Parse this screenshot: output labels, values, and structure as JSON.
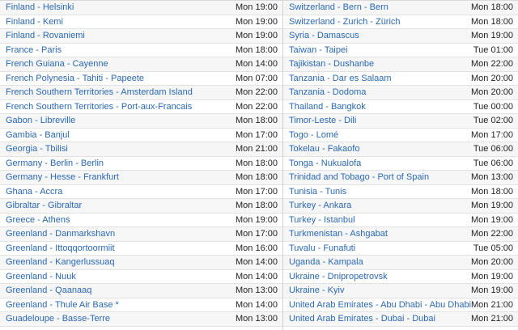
{
  "left_column": [
    {
      "city": "Finland - Helsinki",
      "time": "Mon 19:00"
    },
    {
      "city": "Finland - Kemi",
      "time": "Mon 19:00"
    },
    {
      "city": "Finland - Rovaniemi",
      "time": "Mon 19:00"
    },
    {
      "city": "France - Paris",
      "time": "Mon 18:00"
    },
    {
      "city": "French Guiana - Cayenne",
      "time": "Mon 14:00"
    },
    {
      "city": "French Polynesia - Tahiti - Papeete",
      "time": "Mon 07:00"
    },
    {
      "city": "French Southern Territories - Amsterdam Island",
      "time": "Mon 22:00"
    },
    {
      "city": "French Southern Territories - Port-aux-Francais",
      "time": "Mon 22:00"
    },
    {
      "city": "Gabon - Libreville",
      "time": "Mon 18:00"
    },
    {
      "city": "Gambia - Banjul",
      "time": "Mon 17:00"
    },
    {
      "city": "Georgia - Tbilisi",
      "time": "Mon 21:00"
    },
    {
      "city": "Germany - Berlin - Berlin",
      "time": "Mon 18:00"
    },
    {
      "city": "Germany - Hesse - Frankfurt",
      "time": "Mon 18:00"
    },
    {
      "city": "Ghana - Accra",
      "time": "Mon 17:00"
    },
    {
      "city": "Gibraltar - Gibraltar",
      "time": "Mon 18:00"
    },
    {
      "city": "Greece - Athens",
      "time": "Mon 19:00"
    },
    {
      "city": "Greenland - Danmarkshavn",
      "time": "Mon 17:00"
    },
    {
      "city": "Greenland - Ittoqqortoormiit",
      "time": "Mon 16:00"
    },
    {
      "city": "Greenland - Kangerlussuaq",
      "time": "Mon 14:00"
    },
    {
      "city": "Greenland - Nuuk",
      "time": "Mon 14:00"
    },
    {
      "city": "Greenland - Qaanaaq",
      "time": "Mon 13:00"
    },
    {
      "city": "Greenland - Thule Air Base *",
      "time": "Mon 14:00"
    },
    {
      "city": "Guadeloupe - Basse-Terre",
      "time": "Mon 13:00"
    }
  ],
  "right_column": [
    {
      "city": "Switzerland - Bern - Bern",
      "time": "Mon 18:00"
    },
    {
      "city": "Switzerland - Zurich - Zürich",
      "time": "Mon 18:00"
    },
    {
      "city": "Syria - Damascus",
      "time": "Mon 19:00"
    },
    {
      "city": "Taiwan - Taipei",
      "time": "Tue 01:00"
    },
    {
      "city": "Tajikistan - Dushanbe",
      "time": "Mon 22:00"
    },
    {
      "city": "Tanzania - Dar es Salaam",
      "time": "Mon 20:00"
    },
    {
      "city": "Tanzania - Dodoma",
      "time": "Mon 20:00"
    },
    {
      "city": "Thailand - Bangkok",
      "time": "Tue 00:00"
    },
    {
      "city": "Timor-Leste - Dili",
      "time": "Tue 02:00"
    },
    {
      "city": "Togo - Lomé",
      "time": "Mon 17:00"
    },
    {
      "city": "Tokelau - Fakaofo",
      "time": "Tue 06:00"
    },
    {
      "city": "Tonga - Nukualofa",
      "time": "Tue 06:00"
    },
    {
      "city": "Trinidad and Tobago - Port of Spain",
      "time": "Mon 13:00"
    },
    {
      "city": "Tunisia - Tunis",
      "time": "Mon 18:00"
    },
    {
      "city": "Turkey - Ankara",
      "time": "Mon 19:00"
    },
    {
      "city": "Turkey - Istanbul",
      "time": "Mon 19:00"
    },
    {
      "city": "Turkmenistan - Ashgabat",
      "time": "Mon 22:00"
    },
    {
      "city": "Tuvalu - Funafuti",
      "time": "Tue 05:00"
    },
    {
      "city": "Uganda - Kampala",
      "time": "Mon 20:00"
    },
    {
      "city": "Ukraine - Dnipropetrovsk",
      "time": "Mon 19:00"
    },
    {
      "city": "Ukraine - Kyiv",
      "time": "Mon 19:00"
    },
    {
      "city": "United Arab Emirates - Abu Dhabi - Abu Dhabi",
      "time": "Mon 21:00"
    },
    {
      "city": "United Arab Emirates - Dubai - Dubai",
      "time": "Mon 21:00"
    }
  ],
  "colors": {
    "link": "#2a68b3",
    "text": "#222222",
    "row_alt": "#f6f6f6",
    "border": "#e2e2e2"
  }
}
